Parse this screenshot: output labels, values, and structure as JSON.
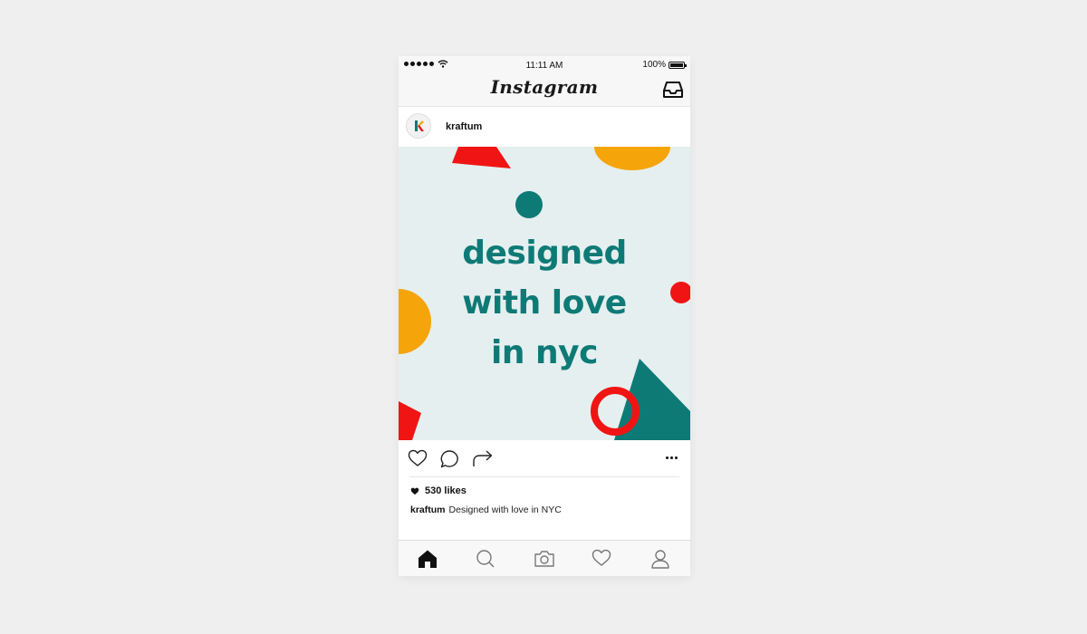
{
  "status_bar": {
    "time": "11:11 AM",
    "battery": "100%"
  },
  "nav": {
    "app_name": "Instagram",
    "inbox_icon": "inbox-icon"
  },
  "post": {
    "username": "kraftum",
    "avatar_letter": "K",
    "image_text": {
      "line1": "designed",
      "line2": "with love",
      "line3": "in nyc"
    },
    "likes_count": "530",
    "likes_label": "likes",
    "caption_user": "kraftum",
    "caption_text": "Designed with love in NYC"
  },
  "actions": {
    "like_icon": "heart-outline-icon",
    "comment_icon": "comment-icon",
    "share_icon": "share-arrow-icon",
    "more_icon": "more-dots-icon"
  },
  "tab_bar": {
    "items": [
      "home-icon",
      "search-icon",
      "camera-icon",
      "heart-icon",
      "profile-icon"
    ],
    "active": "home-icon"
  },
  "colors": {
    "teal": "#0e7a76",
    "red": "#f01414",
    "yellow": "#f5a50a",
    "image_bg": "#e5efef"
  }
}
